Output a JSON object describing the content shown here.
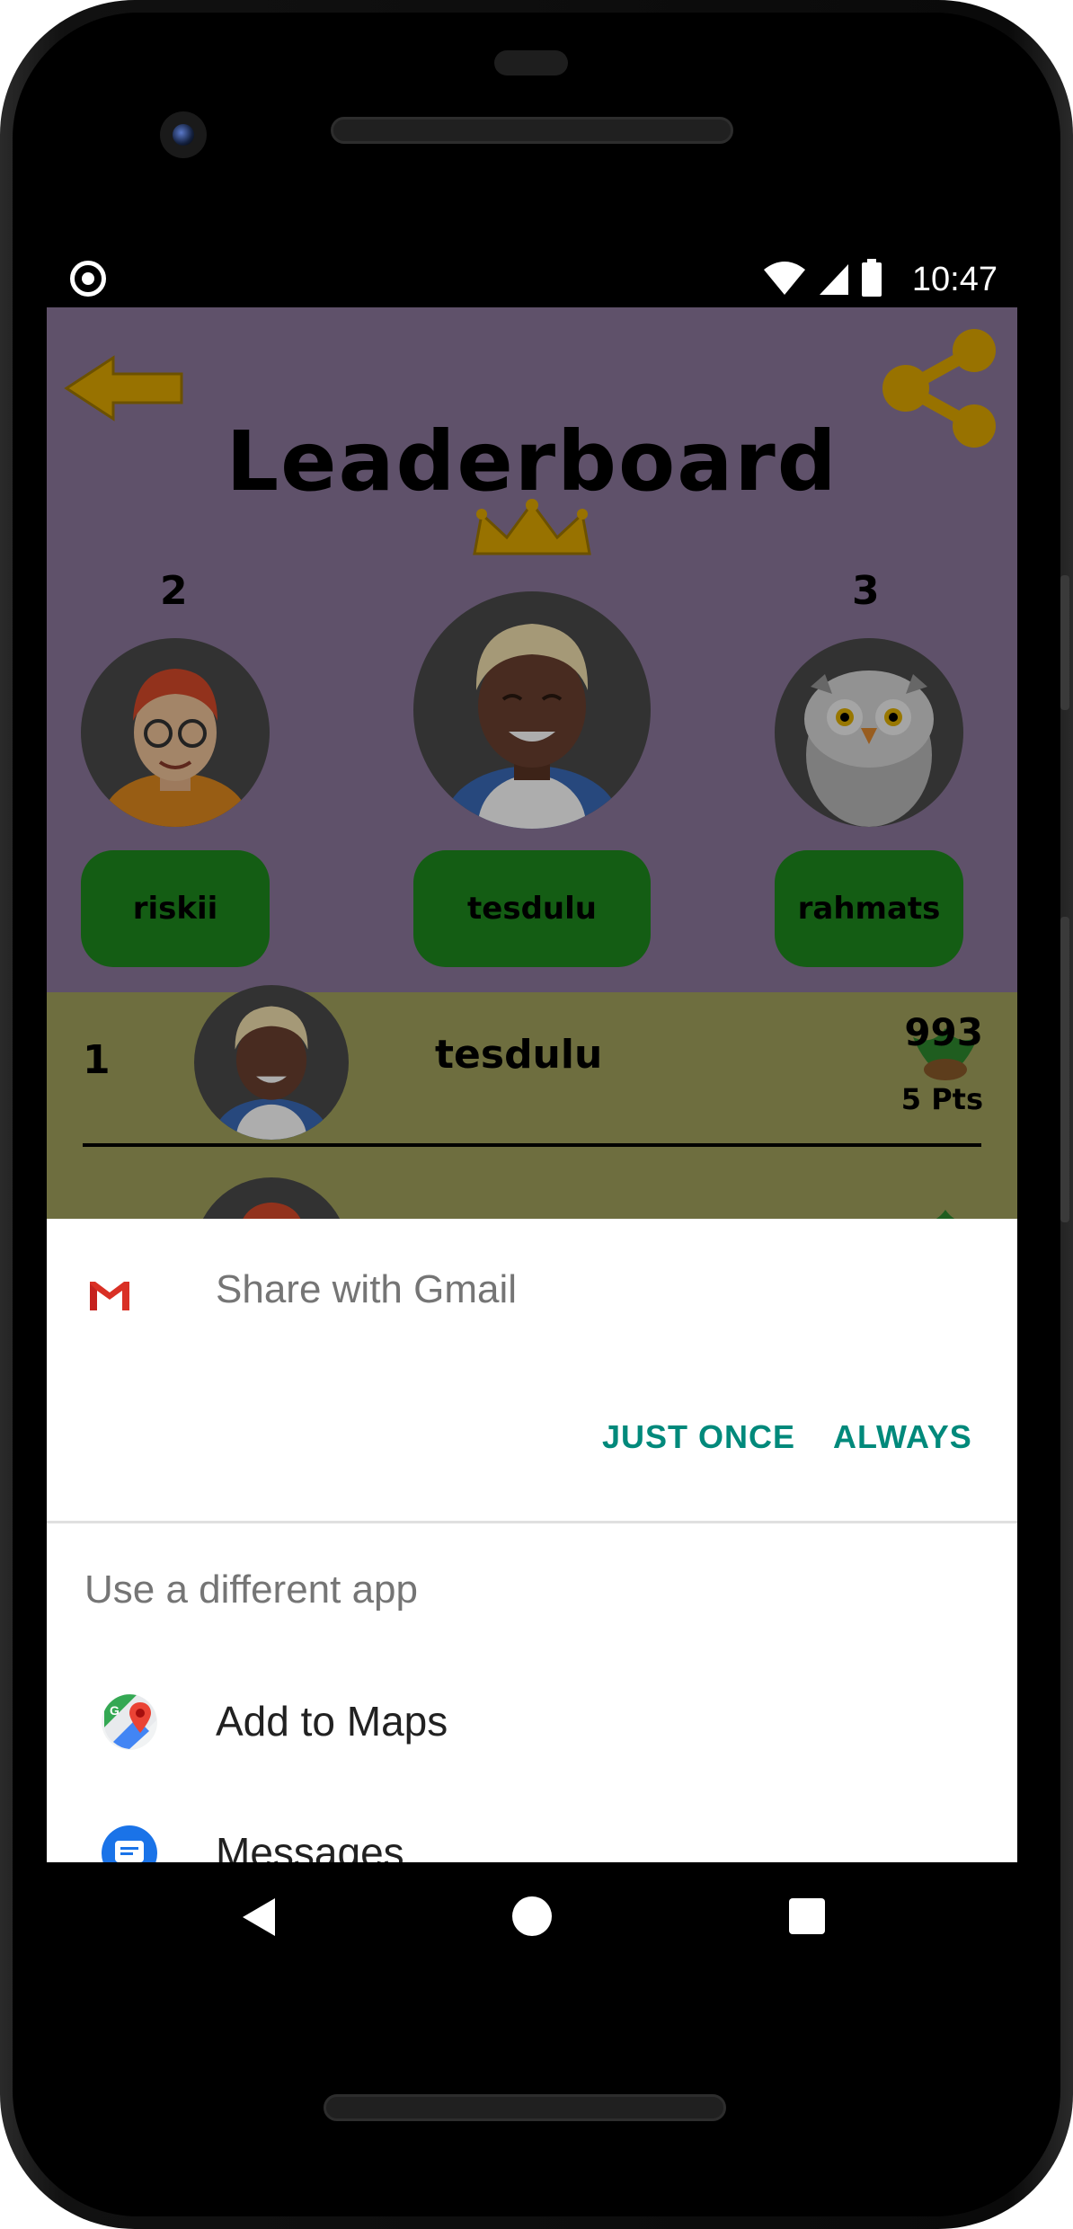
{
  "status_bar": {
    "time": "10:47"
  },
  "leaderboard": {
    "title": "Leaderboard",
    "podium": [
      {
        "rank": "2",
        "name": "riskii"
      },
      {
        "rank": "",
        "name": "tesdulu"
      },
      {
        "rank": "3",
        "name": "rahmats"
      }
    ],
    "rows": [
      {
        "rank": "1",
        "name": "tesdulu",
        "score": "993",
        "points": "5 Pts"
      }
    ]
  },
  "share_sheet": {
    "primary_app": "Share with Gmail",
    "just_once_label": "JUST ONCE",
    "always_label": "ALWAYS",
    "section_title": "Use a different app",
    "apps": [
      {
        "label": "Add to Maps",
        "icon": "maps-icon"
      },
      {
        "label": "Messages",
        "icon": "messages-icon"
      }
    ]
  },
  "colors": {
    "accent": "#00897b",
    "header_bg": "#8d789c",
    "list_bg": "#a3a35e",
    "name_pill": "#1e8a1e"
  }
}
